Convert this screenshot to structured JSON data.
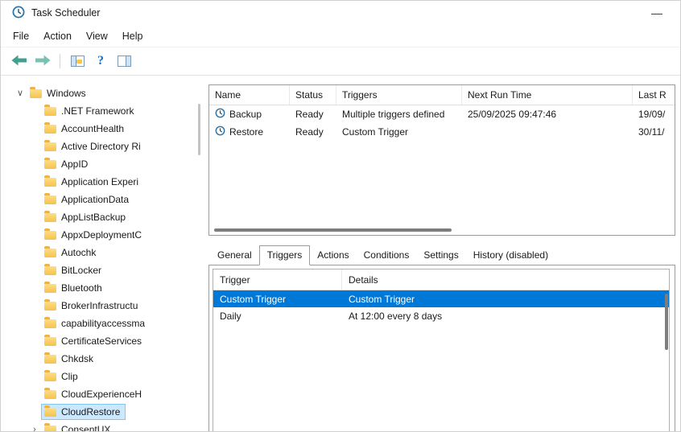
{
  "colors": {
    "selection_blue": "#0078d7",
    "tree_highlight": "#cce8ff",
    "tree_highlight_border": "#84c7f0",
    "arrow_teal": "#43a08f",
    "folder_yellow": "#f7c64a"
  },
  "window": {
    "title": "Task Scheduler",
    "minimize_glyph": "—"
  },
  "menubar": {
    "items": [
      "File",
      "Action",
      "View",
      "Help"
    ]
  },
  "toolbar": {
    "help_glyph": "?",
    "icons": [
      "back-arrow",
      "forward-arrow",
      "console-tree-toggle",
      "help",
      "action-pane-toggle"
    ]
  },
  "tree": {
    "expanded_glyph": "∨",
    "collapsed_glyph": "›",
    "root": "Windows",
    "selected_item": "CloudRestore",
    "items": [
      ".NET Framework",
      "AccountHealth",
      "Active Directory Ri",
      "AppID",
      "Application Experi",
      "ApplicationData",
      "AppListBackup",
      "AppxDeploymentC",
      "Autochk",
      "BitLocker",
      "Bluetooth",
      "BrokerInfrastructu",
      "capabilityaccessma",
      "CertificateServices",
      "Chkdsk",
      "Clip",
      "CloudExperienceH",
      "CloudRestore",
      "ConsentUX"
    ]
  },
  "task_list": {
    "columns": [
      "Name",
      "Status",
      "Triggers",
      "Next Run Time",
      "Last R"
    ],
    "rows": [
      {
        "name": "Backup",
        "status": "Ready",
        "triggers": "Multiple triggers defined",
        "next_run": "25/09/2025 09:47:46",
        "last_run": "19/09/"
      },
      {
        "name": "Restore",
        "status": "Ready",
        "triggers": "Custom Trigger",
        "next_run": "",
        "last_run": "30/11/"
      }
    ]
  },
  "detail": {
    "tabs": [
      "General",
      "Triggers",
      "Actions",
      "Conditions",
      "Settings",
      "History (disabled)"
    ],
    "active_tab": "Triggers",
    "columns": [
      "Trigger",
      "Details"
    ],
    "rows": [
      {
        "trigger": "Custom Trigger",
        "details": "Custom Trigger",
        "selected": true
      },
      {
        "trigger": "Daily",
        "details": "At 12:00 every 8 days",
        "selected": false
      }
    ]
  }
}
